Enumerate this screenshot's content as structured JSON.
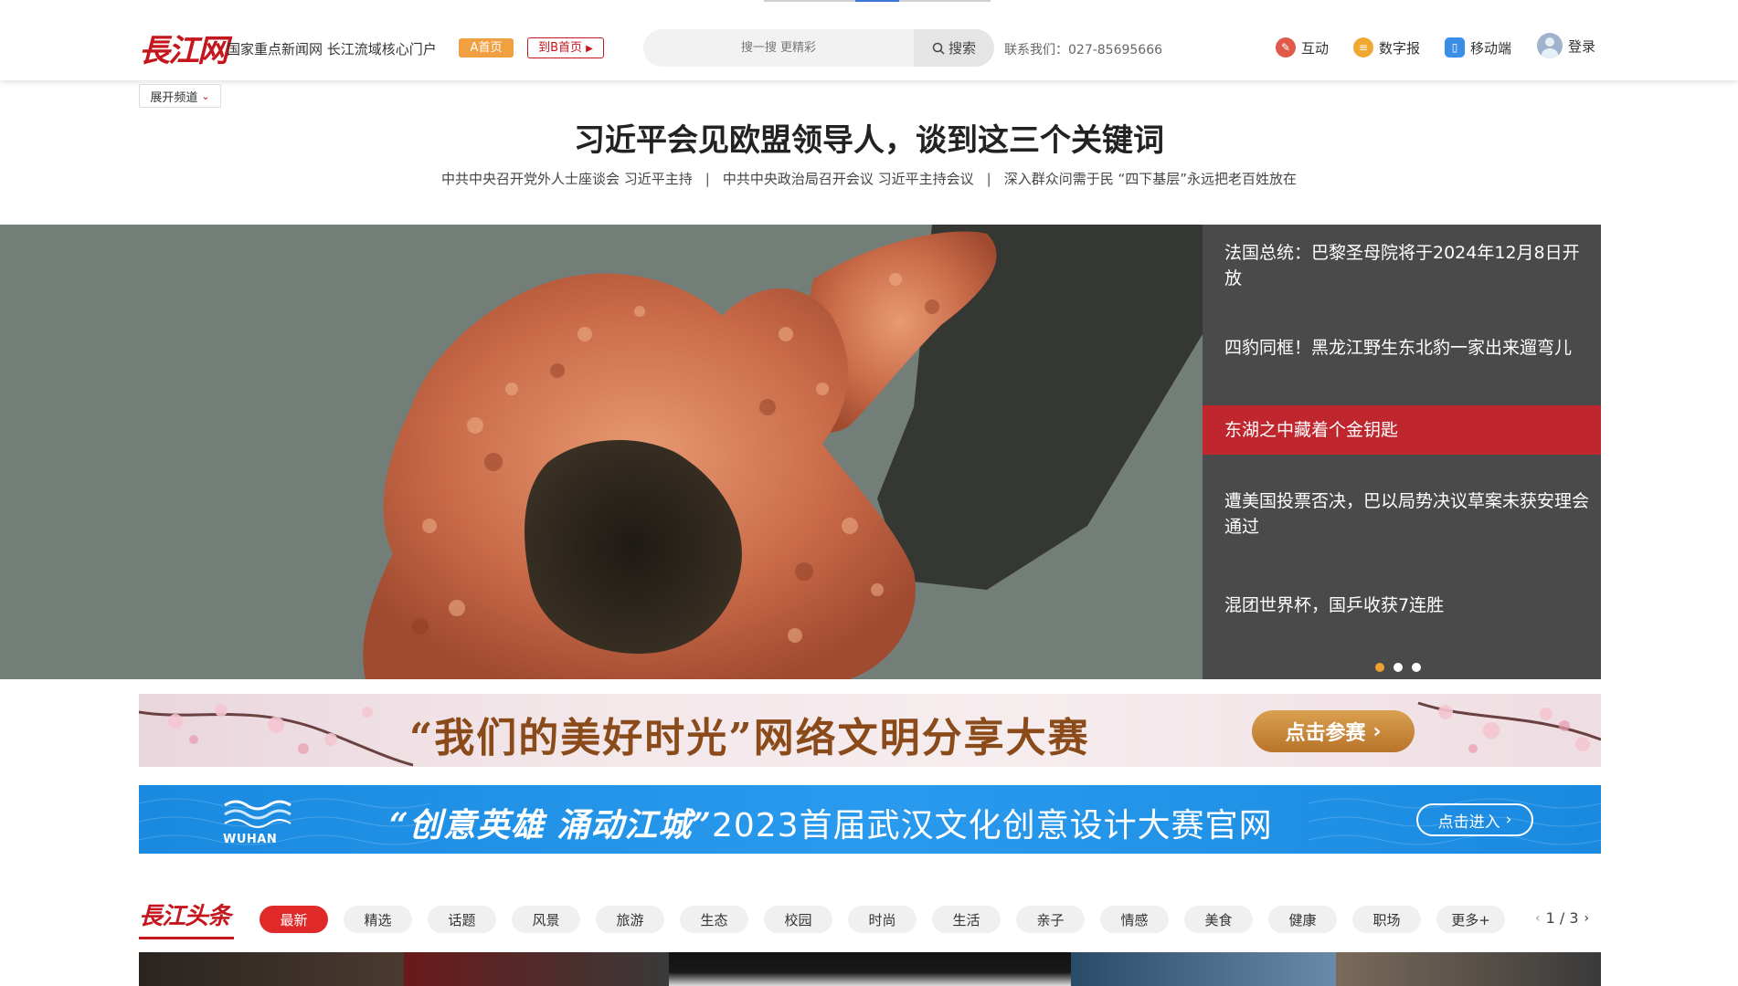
{
  "header": {
    "logo_text": "長江网",
    "slogan": "国家重点新闻网 长江流域核心门户",
    "btn_a_label": "A首页",
    "btn_b_label": "到B首页",
    "search_placeholder": "搜一搜 更精彩",
    "search_button_label": "搜索",
    "contact": "联系我们：027-85695666",
    "tools": [
      {
        "label": "互动",
        "icon": "edit-icon",
        "color": "#e05a4a"
      },
      {
        "label": "数字报",
        "icon": "newspaper-icon",
        "color": "#f0a830"
      },
      {
        "label": "移动端",
        "icon": "mobile-icon",
        "color": "#3a8ee6"
      }
    ],
    "login_label": "登录"
  },
  "channel_toggle_label": "展开频道",
  "headline": {
    "title": "习近平会见欧盟领导人，谈到这三个关键词",
    "subs": [
      "中共中央召开党外人士座谈会 习近平主持",
      "中共中央政治局召开会议 习近平主持会议",
      "深入群众问需于民 “四下基层”永远把老百姓放在"
    ]
  },
  "hero": {
    "items": [
      "法国总统：巴黎圣母院将于2024年12月8日开放",
      "四豹同框！黑龙江野生东北豹一家出来遛弯儿",
      "东湖之中藏着个金钥匙",
      "遭美国投票否决，巴以局势决议草案未获安理会通过",
      "混团世界杯，国乒收获7连胜"
    ],
    "active_index": 2,
    "active_dot": 0
  },
  "banners": {
    "banner1_text": "“我们的美好时光”网络文明分享大赛",
    "banner1_button": "点击参赛",
    "banner2_logo": "WUHAN",
    "banner2_title_italic": "“创意英雄 涌动江城”",
    "banner2_title_rest": "2023首届武汉文化创意设计大赛官网",
    "banner2_button": "点击进入"
  },
  "section": {
    "logo_text": "長江头条",
    "tabs": [
      "最新",
      "精选",
      "话题",
      "风景",
      "旅游",
      "生态",
      "校园",
      "时尚",
      "生活",
      "亲子",
      "情感",
      "美食",
      "健康",
      "职场",
      "更多+"
    ],
    "active_tab": 0,
    "pager": "1 / 3"
  },
  "colors": {
    "brand_red": "#c4161c",
    "active_red": "#c0262d",
    "hero_panel": "#4a4a4a",
    "banner_blue": "#1a8ae0",
    "dot_active": "#f0a030"
  }
}
